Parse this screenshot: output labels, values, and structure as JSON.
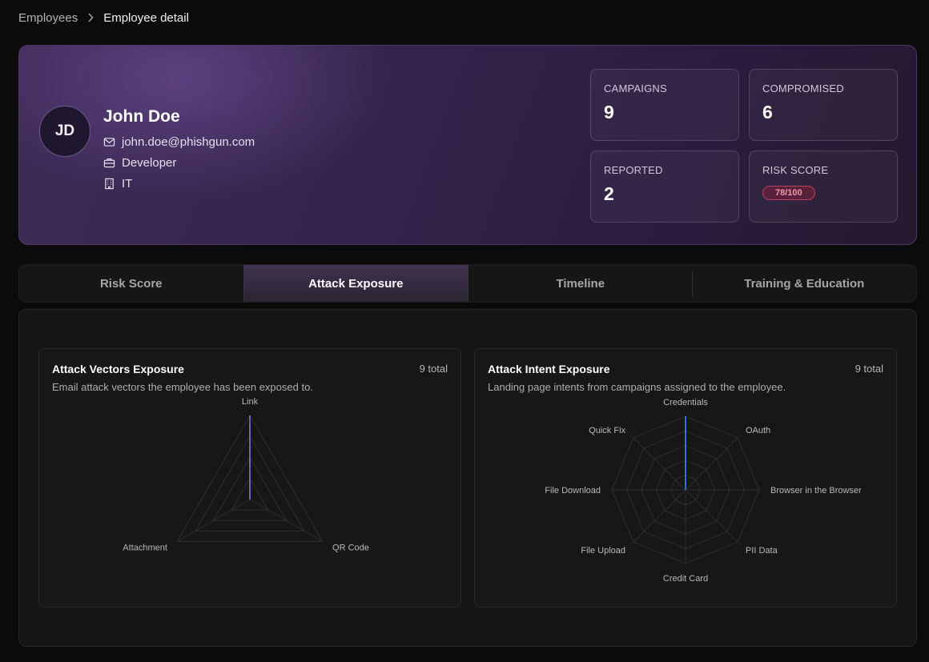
{
  "breadcrumb": {
    "parent": "Employees",
    "current": "Employee detail"
  },
  "profile": {
    "initials": "JD",
    "name": "John Doe",
    "email": "john.doe@phishgun.com",
    "role": "Developer",
    "department": "IT"
  },
  "stats": {
    "campaigns": {
      "label": "CAMPAIGNS",
      "value": "9"
    },
    "compromised": {
      "label": "COMPROMISED",
      "value": "6"
    },
    "reported": {
      "label": "REPORTED",
      "value": "2"
    },
    "risk": {
      "label": "RISK SCORE",
      "value": "78/100"
    }
  },
  "tabs": [
    {
      "label": "Risk Score",
      "active": false
    },
    {
      "label": "Attack Exposure",
      "active": true
    },
    {
      "label": "Timeline",
      "active": false
    },
    {
      "label": "Training & Education",
      "active": false
    }
  ],
  "cards": {
    "vectors": {
      "title": "Attack Vectors Exposure",
      "total": "9 total",
      "subtitle": "Email attack vectors the employee has been exposed to."
    },
    "intent": {
      "title": "Attack Intent Exposure",
      "total": "9 total",
      "subtitle": "Landing page intents from campaigns assigned to the employee."
    }
  },
  "chart_data": [
    {
      "type": "radar",
      "axes": [
        "Link",
        "QR Code",
        "Attachment"
      ],
      "values": [
        9,
        0,
        0
      ],
      "max": 9,
      "rings": 4,
      "color": "#7a5bc4"
    },
    {
      "type": "radar",
      "axes": [
        "Credentials",
        "OAuth",
        "Browser in the Browser",
        "PII Data",
        "Credit Card",
        "File Upload",
        "File Download",
        "Quick Fix"
      ],
      "values": [
        9,
        0,
        0,
        0,
        0,
        0,
        0,
        0
      ],
      "max": 9,
      "rings": 5,
      "color": "#3b6fd8"
    }
  ],
  "colors": {
    "accent": "#7a5bc4",
    "risk_badge": "#f09aa8"
  }
}
